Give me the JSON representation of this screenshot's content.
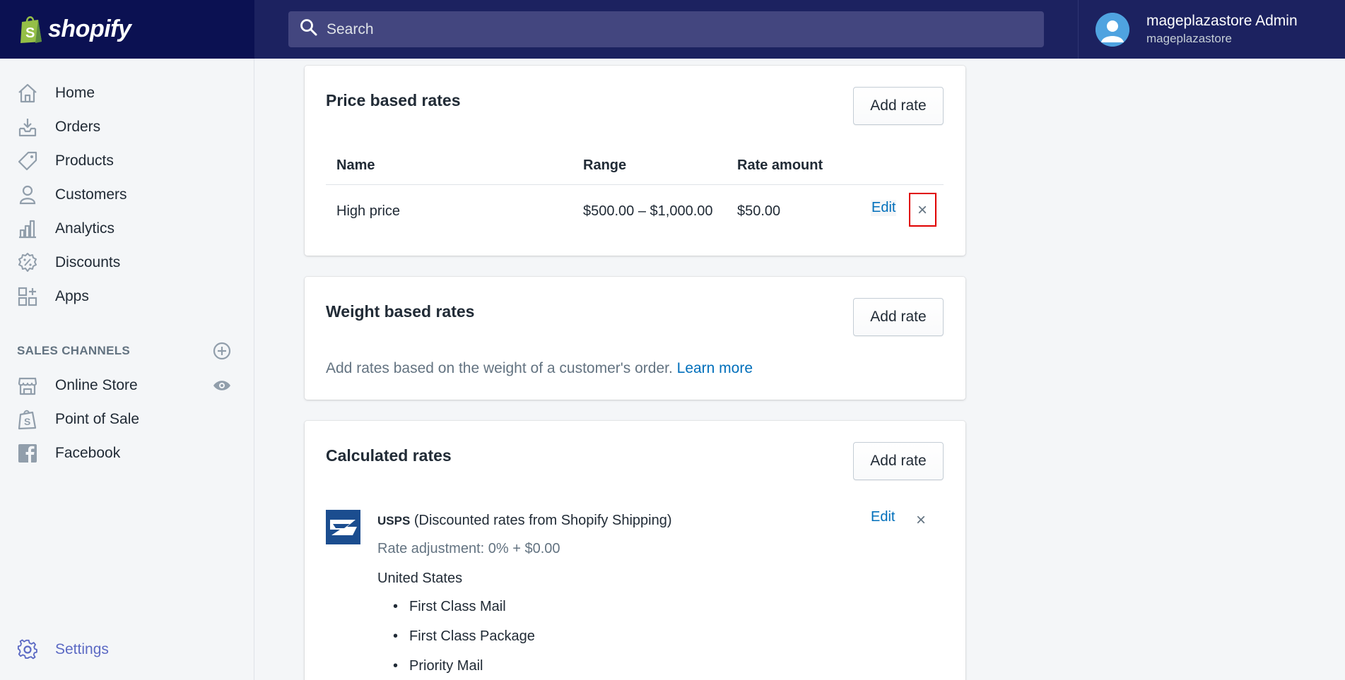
{
  "header": {
    "logo_text": "shopify",
    "search_placeholder": "Search",
    "user_name": "mageplazastore Admin",
    "user_store": "mageplazastore"
  },
  "sidebar": {
    "items": [
      {
        "label": "Home",
        "icon": "home-icon"
      },
      {
        "label": "Orders",
        "icon": "orders-icon"
      },
      {
        "label": "Products",
        "icon": "tag-icon"
      },
      {
        "label": "Customers",
        "icon": "person-icon"
      },
      {
        "label": "Analytics",
        "icon": "bar-chart-icon"
      },
      {
        "label": "Discounts",
        "icon": "discount-icon"
      },
      {
        "label": "Apps",
        "icon": "apps-icon"
      }
    ],
    "channels_header": "SALES CHANNELS",
    "channels": [
      {
        "label": "Online Store",
        "icon": "store-icon"
      },
      {
        "label": "Point of Sale",
        "icon": "shopping-bag-icon"
      },
      {
        "label": "Facebook",
        "icon": "facebook-icon"
      }
    ],
    "settings_label": "Settings"
  },
  "price_rates": {
    "title": "Price based rates",
    "add_button": "Add rate",
    "columns": [
      "Name",
      "Range",
      "Rate amount"
    ],
    "row": {
      "name": "High price",
      "range": "$500.00 – $1,000.00",
      "amount": "$50.00",
      "edit": "Edit",
      "delete": "×"
    }
  },
  "weight_rates": {
    "title": "Weight based rates",
    "add_button": "Add rate",
    "description": "Add rates based on the weight of a customer's order.",
    "learn_more": "Learn more"
  },
  "calculated_rates": {
    "title": "Calculated rates",
    "add_button": "Add rate",
    "carrier_name": "USPS",
    "carrier_note": "(Discounted rates from Shopify Shipping)",
    "edit": "Edit",
    "delete": "×",
    "adjustment": "Rate adjustment: 0% + $0.00",
    "country": "United States",
    "methods": [
      "First Class Mail",
      "First Class Package",
      "Priority Mail"
    ]
  },
  "colors": {
    "topbar": "#1c2260",
    "logo_bg": "#0b1152",
    "link": "#006fbb",
    "highlight": "#e00000"
  }
}
